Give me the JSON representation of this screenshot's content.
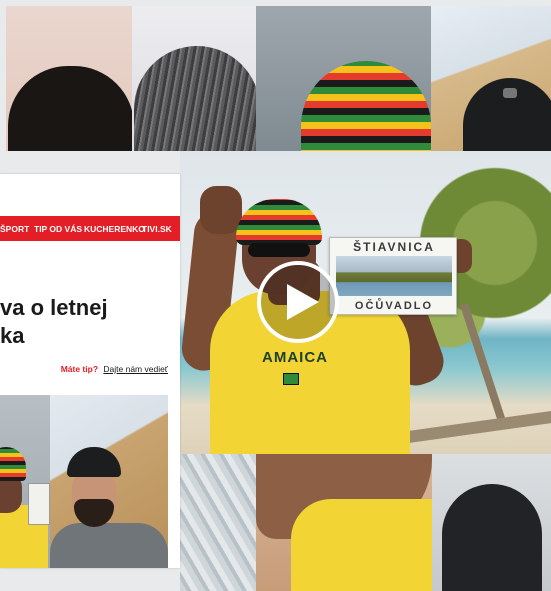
{
  "article": {
    "nav": {
      "sport": "ŠPORT",
      "tip_od_vas": "TIP OD VÁS",
      "kucherenko": "KUCHERENKO",
      "tivi": "TIVI.SK"
    },
    "headline": "va o letnej\nka",
    "tip_label": "Máte tip?",
    "tip_link": "Dajte nám vedieť"
  },
  "video": {
    "postcard_top": "ŠTIAVNICA",
    "postcard_bottom": "OČŮVADLO",
    "shirt_text": "AMAICA",
    "play_icon": "play-icon"
  },
  "colors": {
    "brand_red": "#e41e26",
    "play_ring": "#ffffff"
  }
}
